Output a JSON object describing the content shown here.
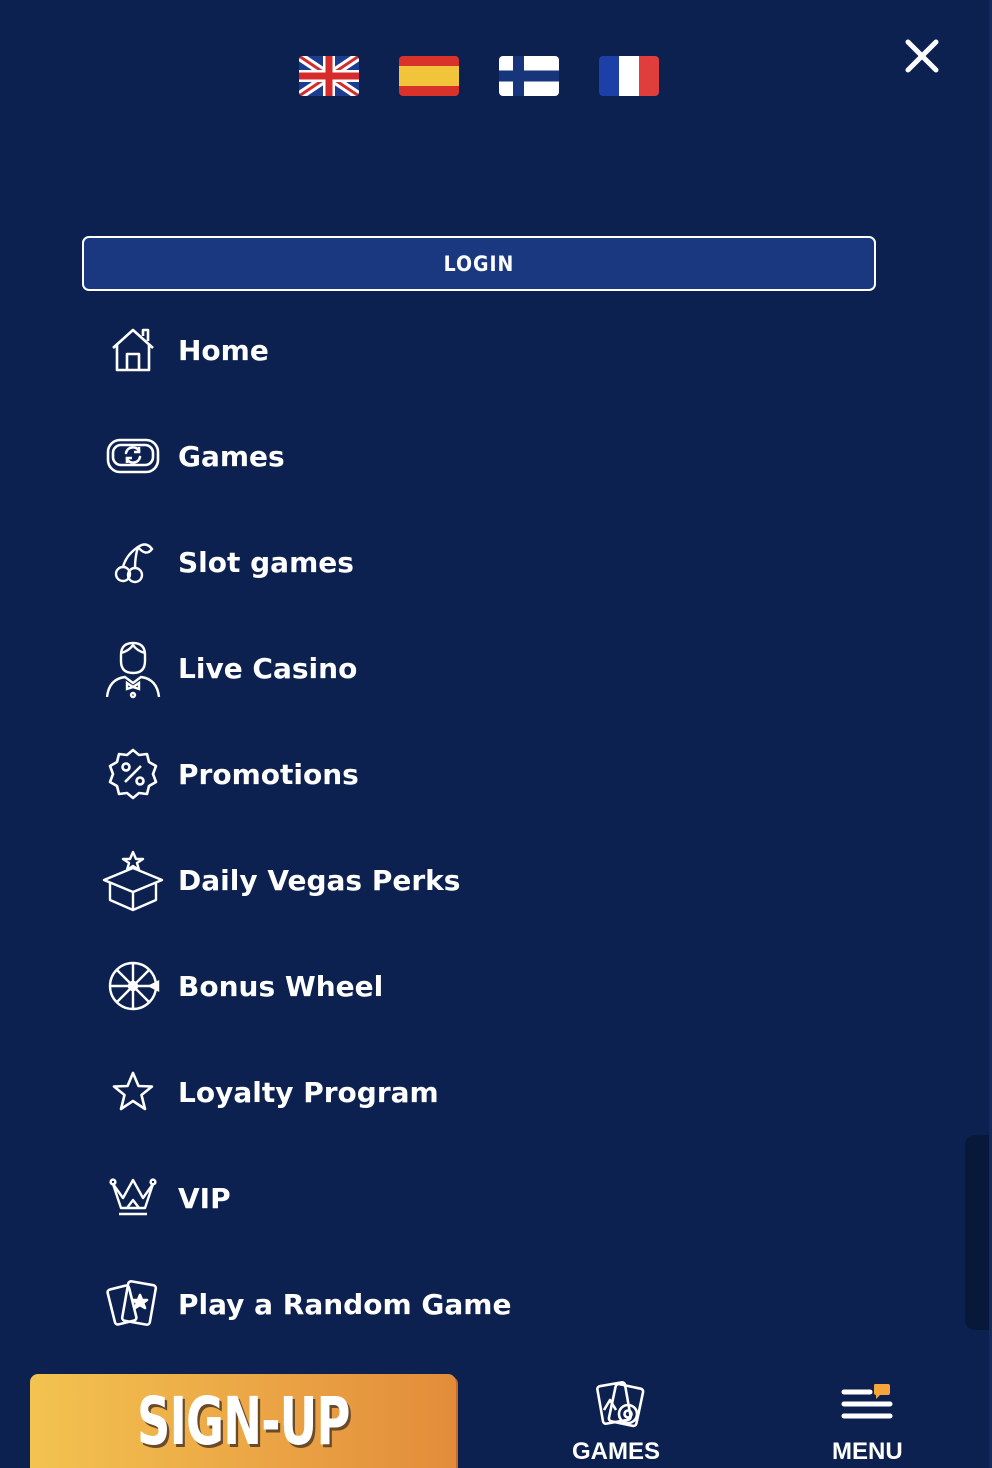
{
  "header": {
    "languages": [
      {
        "name": "English",
        "icon": "uk-flag-icon"
      },
      {
        "name": "Spanish",
        "icon": "spain-flag-icon"
      },
      {
        "name": "Finnish",
        "icon": "finland-flag-icon"
      },
      {
        "name": "French",
        "icon": "france-flag-icon"
      }
    ],
    "close_icon": "close-icon"
  },
  "login": {
    "label": "LOGIN"
  },
  "menu": {
    "items": [
      {
        "label": "Home",
        "icon": "house-icon"
      },
      {
        "label": "Games",
        "icon": "games-icon"
      },
      {
        "label": "Slot games",
        "icon": "cherries-icon"
      },
      {
        "label": "Live Casino",
        "icon": "dealer-icon"
      },
      {
        "label": "Promotions",
        "icon": "percent-badge-icon"
      },
      {
        "label": "Daily Vegas Perks",
        "icon": "gift-box-icon"
      },
      {
        "label": "Bonus Wheel",
        "icon": "wheel-icon"
      },
      {
        "label": "Loyalty Program",
        "icon": "star-icon"
      },
      {
        "label": "VIP",
        "icon": "crown-icon"
      },
      {
        "label": "Play a Random Game",
        "icon": "cards-icon"
      }
    ]
  },
  "bottom_bar": {
    "signup_label": "SIGN-UP",
    "games_label": "GAMES",
    "menu_label": "MENU"
  },
  "colors": {
    "background": "#0c2150",
    "login_button": "#1a3880",
    "signup_start": "#f3c350",
    "signup_end": "#e28c3a",
    "notification_dot": "#f5a53a"
  }
}
